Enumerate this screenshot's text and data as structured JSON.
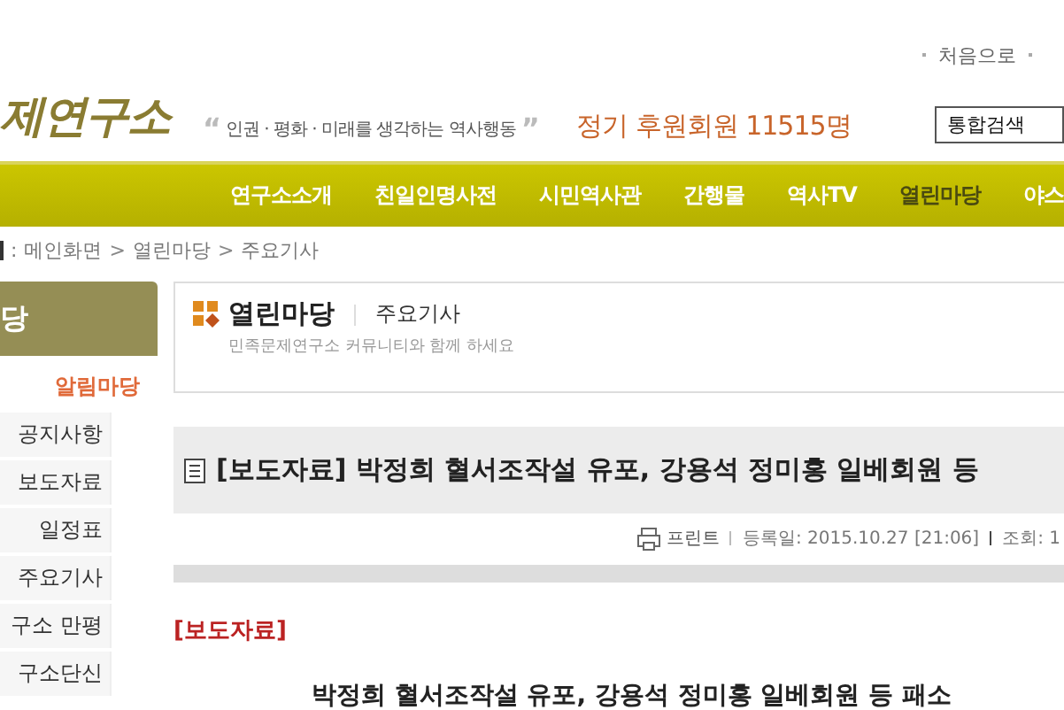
{
  "top_links": [
    "처음으로"
  ],
  "logo": {
    "text": "제연구소"
  },
  "tagline": {
    "open_quote": "“",
    "text": "인권 · 평화 · 미래를 생각하는 역사행동",
    "close_quote": "”"
  },
  "members": "정기 후원회원 11515명",
  "search_select": "통합검색",
  "nav": [
    {
      "label": "연구소소개",
      "selected": false
    },
    {
      "label": "친일인명사전",
      "selected": false
    },
    {
      "label": "시민역사관",
      "selected": false
    },
    {
      "label": "간행물",
      "selected": false
    },
    {
      "label": "역사TV",
      "selected": false
    },
    {
      "label": "열린마당",
      "selected": true
    },
    {
      "label": "야스",
      "selected": false
    }
  ],
  "breadcrumb": {
    "prefix": ": ",
    "items": [
      "메인화면",
      "열린마당",
      "주요기사"
    ],
    "separator": ">"
  },
  "sidebar": {
    "title": "당",
    "section": "알림마당",
    "items": [
      {
        "label": "공지사항",
        "selected": false
      },
      {
        "label": "보도자료",
        "selected": false
      },
      {
        "label": "일정표",
        "selected": false
      },
      {
        "label": "주요기사",
        "selected": false
      },
      {
        "label": "구소 만평",
        "selected": false
      },
      {
        "label": "구소단신",
        "selected": false
      }
    ]
  },
  "section_box": {
    "title": "열린마당",
    "subtitle": "주요기사",
    "description": "민족문제연구소 커뮤니티와 함께 하세요"
  },
  "article": {
    "title": "[보도자료] 박정희 혈서조작설 유포, 강용석 정미홍 일베회원 등",
    "print": "프린트",
    "date": "등록일: 2015.10.27 [21:06]",
    "views": "조회: 1",
    "tag": "[보도자료]",
    "headline": "박정희 혈서조작설 유포, 강용석 정미홍 일베회원 등 패소"
  }
}
